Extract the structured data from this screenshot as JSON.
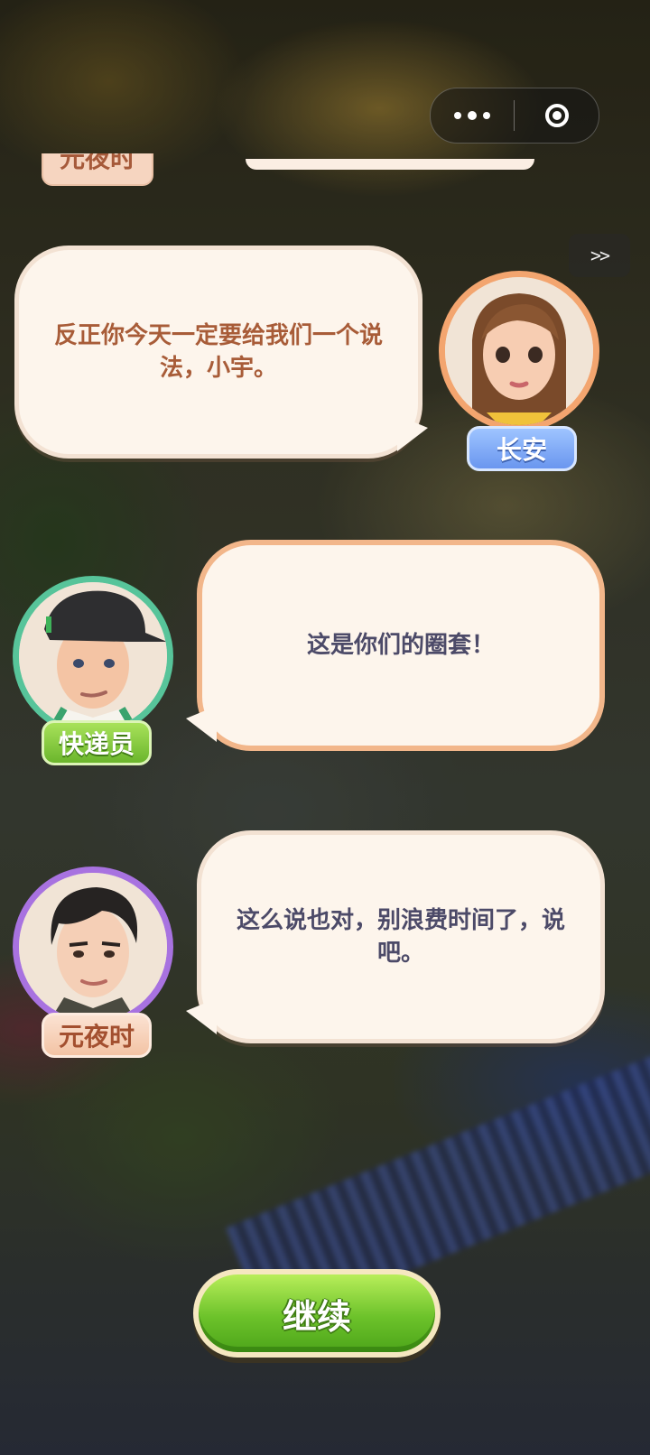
{
  "top_capsule": {
    "more_icon": "ellipsis-icon",
    "close_icon": "target-icon"
  },
  "skip": {
    "label": ">>"
  },
  "previous": {
    "speaker_name": "元夜时"
  },
  "dialogue": [
    {
      "speaker": "长安",
      "text": "反正你今天一定要给我们一个说法，小宇。",
      "ring_color": "#f3a56f",
      "nameplate_color": "#7aa4f4"
    },
    {
      "speaker": "快递员",
      "text": "这是你们的圈套！",
      "ring_color": "#57c49a",
      "nameplate_color": "#79c236"
    },
    {
      "speaker": "元夜时",
      "text": "这么说也对，别浪费时间了，说吧。",
      "ring_color": "#a872e0",
      "nameplate_color": "#f6cfb6"
    }
  ],
  "continue_button": {
    "label": "继续",
    "color": "#6cc22a"
  }
}
